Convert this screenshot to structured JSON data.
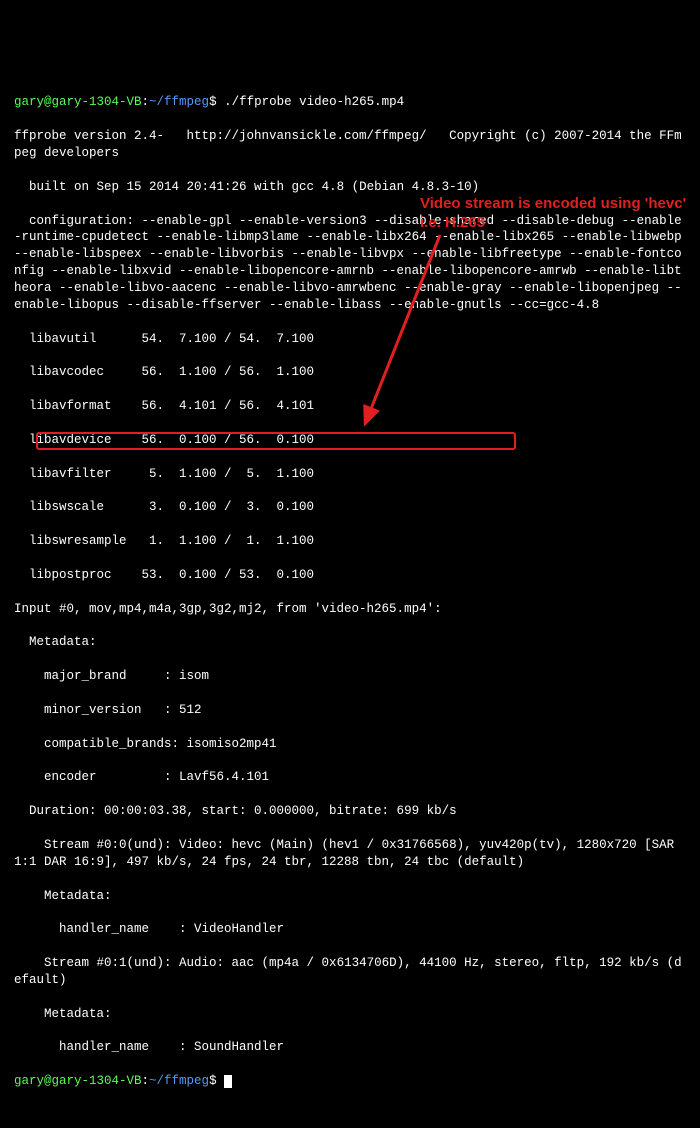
{
  "prompt": {
    "user": "gary@gary-1304-VB",
    "sep1": ":",
    "path": "~/ffmpeg",
    "sep2": "$ "
  },
  "cmd": "./ffprobe video-h265.mp4",
  "lines": {
    "l1": "ffprobe version 2.4-   http://johnvansickle.com/ffmpeg/   Copyright (c) 2007-2014 the FFmpeg developers",
    "l2": "  built on Sep 15 2014 20:41:26 with gcc 4.8 (Debian 4.8.3-10)",
    "l3": "  configuration: --enable-gpl --enable-version3 --disable-shared --disable-debug --enable-runtime-cpudetect --enable-libmp3lame --enable-libx264 --enable-libx265 --enable-libwebp --enable-libspeex --enable-libvorbis --enable-libvpx --enable-libfreetype --enable-fontconfig --enable-libxvid --enable-libopencore-amrnb --enable-libopencore-amrwb --enable-libtheora --enable-libvo-aacenc --enable-libvo-amrwbenc --enable-gray --enable-libopenjpeg --enable-libopus --disable-ffserver --enable-libass --enable-gnutls --cc=gcc-4.8",
    "lib1": "  libavutil      54.  7.100 / 54.  7.100",
    "lib2": "  libavcodec     56.  1.100 / 56.  1.100",
    "lib3": "  libavformat    56.  4.101 / 56.  4.101",
    "lib4": "  libavdevice    56.  0.100 / 56.  0.100",
    "lib5": "  libavfilter     5.  1.100 /  5.  1.100",
    "lib6": "  libswscale      3.  0.100 /  3.  0.100",
    "lib7": "  libswresample   1.  1.100 /  1.  1.100",
    "lib8": "  libpostproc    53.  0.100 / 53.  0.100",
    "inp": "Input #0, mov,mp4,m4a,3gp,3g2,mj2, from 'video-h265.mp4':",
    "meta": "  Metadata:",
    "mb": "    major_brand     : isom",
    "mv": "    minor_version   : 512",
    "cb": "    compatible_brands: isomiso2mp41",
    "enc": "    encoder         : Lavf56.4.101",
    "dur": "  Duration: 00:00:03.38, start: 0.000000, bitrate: 699 kb/s",
    "s0_a": "    Stream #0:0(und): Video: hevc (Main) (hev1 / 0x31766568)",
    "s0_b": ", yuv420p(tv), 1280x720 [SAR 1:1 DAR 16:9], 497 kb/s, 24 fps, 24 tbr, 12288 tbn, 24 tbc (default)",
    "meta2": "    Metadata:",
    "hn": "      handler_name    : VideoHandler",
    "s1": "    Stream #0:1(und): Audio: aac (mp4a / 0x6134706D), 44100 Hz, stereo, fltp, 192 kb/s (default)",
    "meta3": "    Metadata:",
    "hn2": "      handler_name    : SoundHandler"
  },
  "annotation": {
    "line1": "Video stream is encoded using 'hevc'",
    "line2": "i.e. H.265"
  }
}
